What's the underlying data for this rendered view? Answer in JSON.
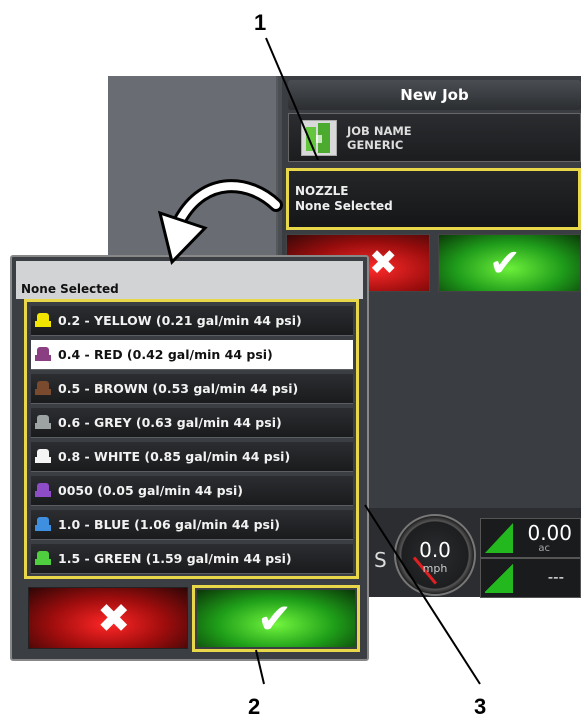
{
  "callouts": {
    "c1": "1",
    "c2": "2",
    "c3": "3"
  },
  "colors": {
    "highlight": "#e9d74a",
    "ok_green": "#1f9f19",
    "cancel_red": "#a00d0d"
  },
  "new_job": {
    "title": "New Job",
    "job_name_label": "JOB NAME",
    "job_name_value": "GENERIC",
    "nozzle_label": "NOZZLE",
    "nozzle_value": "None Selected",
    "cancel_icon": "close-icon",
    "confirm_icon": "checkmark-icon"
  },
  "status": {
    "speed_value": "0.0",
    "speed_unit": "mph",
    "partial_text": "S",
    "area_value": "0.00",
    "area_unit": "ac",
    "rate_value": "---"
  },
  "dropdown": {
    "header": "None Selected",
    "items": [
      {
        "label": "0.2 - YELLOW (0.21 gal/min 44 psi)",
        "color": "#f2e600"
      },
      {
        "label": "0.4 - RED (0.42 gal/min 44 psi)",
        "color": "#8a3f83"
      },
      {
        "label": "0.5 - BROWN (0.53 gal/min 44 psi)",
        "color": "#7a4a2e"
      },
      {
        "label": "0.6 - GREY (0.63 gal/min 44 psi)",
        "color": "#9da3a3"
      },
      {
        "label": "0.8 - WHITE (0.85 gal/min 44 psi)",
        "color": "#f4f4f4"
      },
      {
        "label": "0050 (0.05 gal/min 44 psi)",
        "color": "#8f4cc7"
      },
      {
        "label": "1.0 - BLUE (1.06 gal/min 44 psi)",
        "color": "#3f8fe0"
      },
      {
        "label": "1.5 - GREEN (1.59 gal/min 44 psi)",
        "color": "#4fcf3f"
      }
    ],
    "selected_index": 1,
    "cancel_icon": "close-icon",
    "confirm_icon": "checkmark-icon"
  }
}
